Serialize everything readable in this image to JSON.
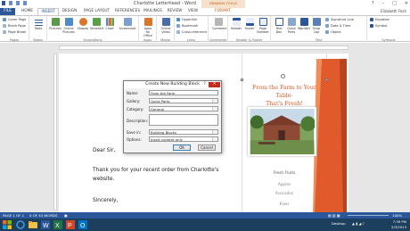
{
  "window": {
    "title": "Charlotte Letterhead - Word",
    "contextual_tab_group": "DRAWING TOOLS",
    "controls": [
      "?",
      "–",
      "□",
      "✕"
    ]
  },
  "tabs": [
    "FILE",
    "HOME",
    "INSERT",
    "DESIGN",
    "PAGE LAYOUT",
    "REFERENCES",
    "MAILINGS",
    "REVIEW",
    "VIEW",
    "FORMAT"
  ],
  "user_name": "Elizabeth Fesh",
  "ribbon": {
    "pages": {
      "label": "Pages",
      "items": [
        "Cover Page",
        "Blank Page",
        "Page Break"
      ]
    },
    "tables": {
      "label": "Tables",
      "button": "Table"
    },
    "illustrations": {
      "label": "Illustrations",
      "buttons": [
        "Pictures",
        "Online Pictures",
        "Shapes",
        "SmartArt",
        "Chart",
        "Screenshot"
      ]
    },
    "apps": {
      "label": "Apps",
      "button": "Apps for Office"
    },
    "media": {
      "label": "Media",
      "button": "Online Video"
    },
    "links": {
      "label": "Links",
      "items": [
        "Hyperlink",
        "Bookmark",
        "Cross-reference"
      ]
    },
    "comments": {
      "label": "Comments",
      "button": "Comment"
    },
    "header_footer": {
      "label": "Header & Footer",
      "buttons": [
        "Header",
        "Footer",
        "Page Number"
      ]
    },
    "text": {
      "label": "Text",
      "buttons": [
        "Text Box",
        "Quick Parts",
        "WordArt",
        "Drop Cap"
      ],
      "items": [
        "Signature Line",
        "Date & Time",
        "Object"
      ]
    },
    "symbols": {
      "label": "Symbols",
      "items": [
        "Equation",
        "Symbol"
      ]
    }
  },
  "dialog": {
    "title": "Create New Building Block",
    "help": "?",
    "fields": [
      {
        "label": "Name:",
        "value": "From the Farm"
      },
      {
        "label": "Gallery:",
        "value": "Quick Parts"
      },
      {
        "label": "Category:",
        "value": "General"
      },
      {
        "label": "Description:",
        "value": ""
      },
      {
        "label": "Save in:",
        "value": "Building Blocks"
      },
      {
        "label": "Options:",
        "value": "Insert content only"
      }
    ],
    "ok": "OK",
    "cancel": "Cancel"
  },
  "document": {
    "greeting": "Dear Sir,",
    "line1": "Thank you for your recent order from Charlotte's",
    "line2": "website.",
    "closing": "Sincerely,",
    "sidebar_title_1": "From the Farm to Your Table-",
    "sidebar_title_2": "That's Fresh!",
    "sidebar_list_head": "Fresh Fruits",
    "sidebar_list": [
      "Apples",
      "Avocados",
      "Kiwis"
    ]
  },
  "status": {
    "page": "PAGE 1 OF 1",
    "words": "0 OF 43 WORDS",
    "zoom": "100%"
  },
  "taskbar": {
    "location": "Desktop",
    "time": "7:39 PM",
    "date": "2/3/2013"
  },
  "colors": {
    "word_blue": "#2b579a",
    "sidebar_orange": "#e05a2b",
    "taskbar": "#1d3f5e",
    "close_red": "#c42b1c"
  }
}
